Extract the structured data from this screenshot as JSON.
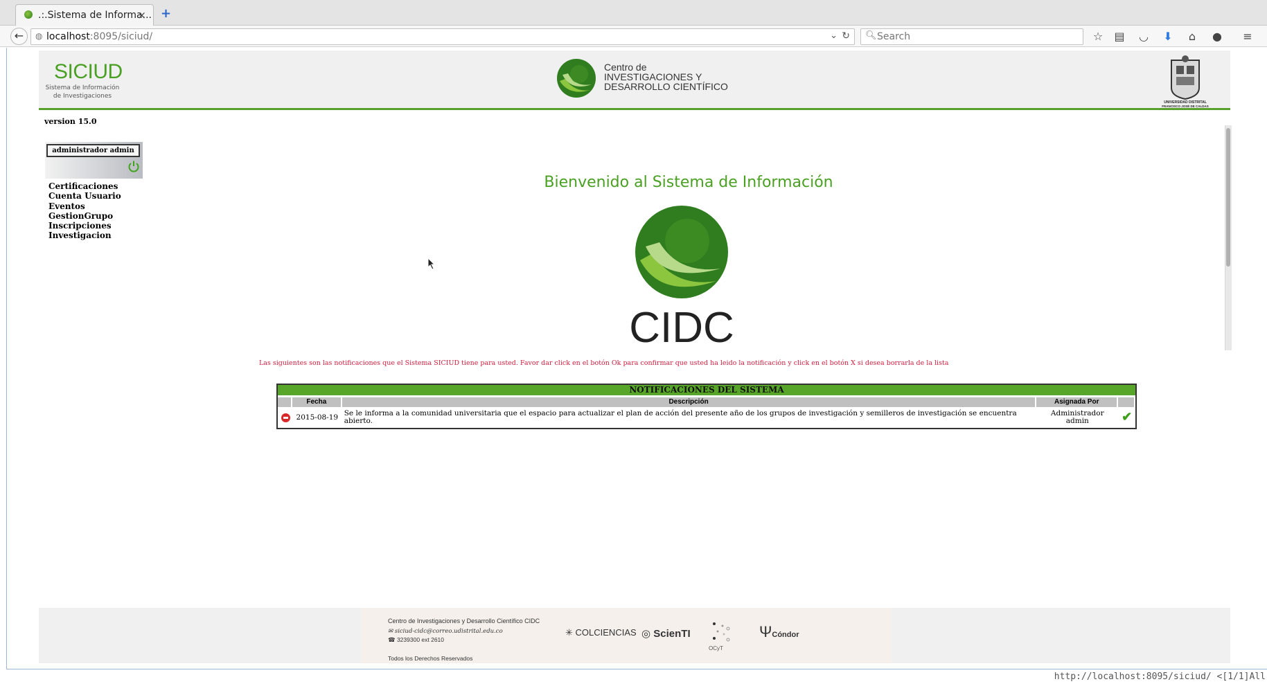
{
  "browser": {
    "tab_title": ".:.Sistema de Informa...",
    "tab_close": "×",
    "new_tab": "+",
    "url_host": "localhost",
    "url_path": ":8095/siciud/",
    "search_placeholder": "Search",
    "status_url": "http://localhost:8095/siciud/ <[1/1]All"
  },
  "header": {
    "siciud_title": "SICIUD",
    "siciud_subtitle": "Sistema de Información de Investigaciones",
    "cidc_line1": "Centro de",
    "cidc_line2": "INVESTIGACIONES Y",
    "cidc_line3": "DESARROLLO CIENTÍFICO",
    "crest_caption": "UNIVERSIDAD DISTRITAL FRANCISCO JOSÉ DE CALDAS"
  },
  "version": "version 15.0",
  "user": {
    "name": "administrador admin"
  },
  "menu": [
    "Certificaciones",
    "Cuenta Usuario",
    "Eventos",
    "GestionGrupo",
    "Inscripciones",
    "Investigacion"
  ],
  "welcome": "Bienvenido al Sistema de Información",
  "big_logo_text": "CIDC",
  "notice": "Las siguientes son las notificaciones que el Sistema SICIUD tiene para usted. Favor dar click en el botón Ok para confirmar que usted ha leido la notificación y click en el botón X si desea borrarla de la lista",
  "notifications": {
    "title": "NOTIFICACIONES DEL SISTEMA",
    "headers": {
      "fecha": "Fecha",
      "descripcion": "Descripción",
      "asignada": "Asignada Por"
    },
    "row": {
      "fecha": "2015-08-19",
      "descripcion": "Se le informa a la comunidad universitaria que el espacio para actualizar el plan de acción del presente año de los grupos de investigación y semilleros de investigación se encuentra abierto.",
      "asignada_1": "Administrador",
      "asignada_2": "admin"
    }
  },
  "footer": {
    "org": "Centro de Investigaciones y Desarrollo Científico CIDC",
    "email": "siciud-cidc@correo.udistrital.edu.co",
    "phone": "3239300 ext 2610",
    "rights": "Todos los Derechos Reservados",
    "partners": [
      "COLCIENCIAS",
      "ScienTI",
      "OCyT",
      "Cóndor"
    ]
  },
  "colors": {
    "accent_green": "#4aa023",
    "notice_red": "#d01c3c",
    "header_bar": "#58a629"
  }
}
